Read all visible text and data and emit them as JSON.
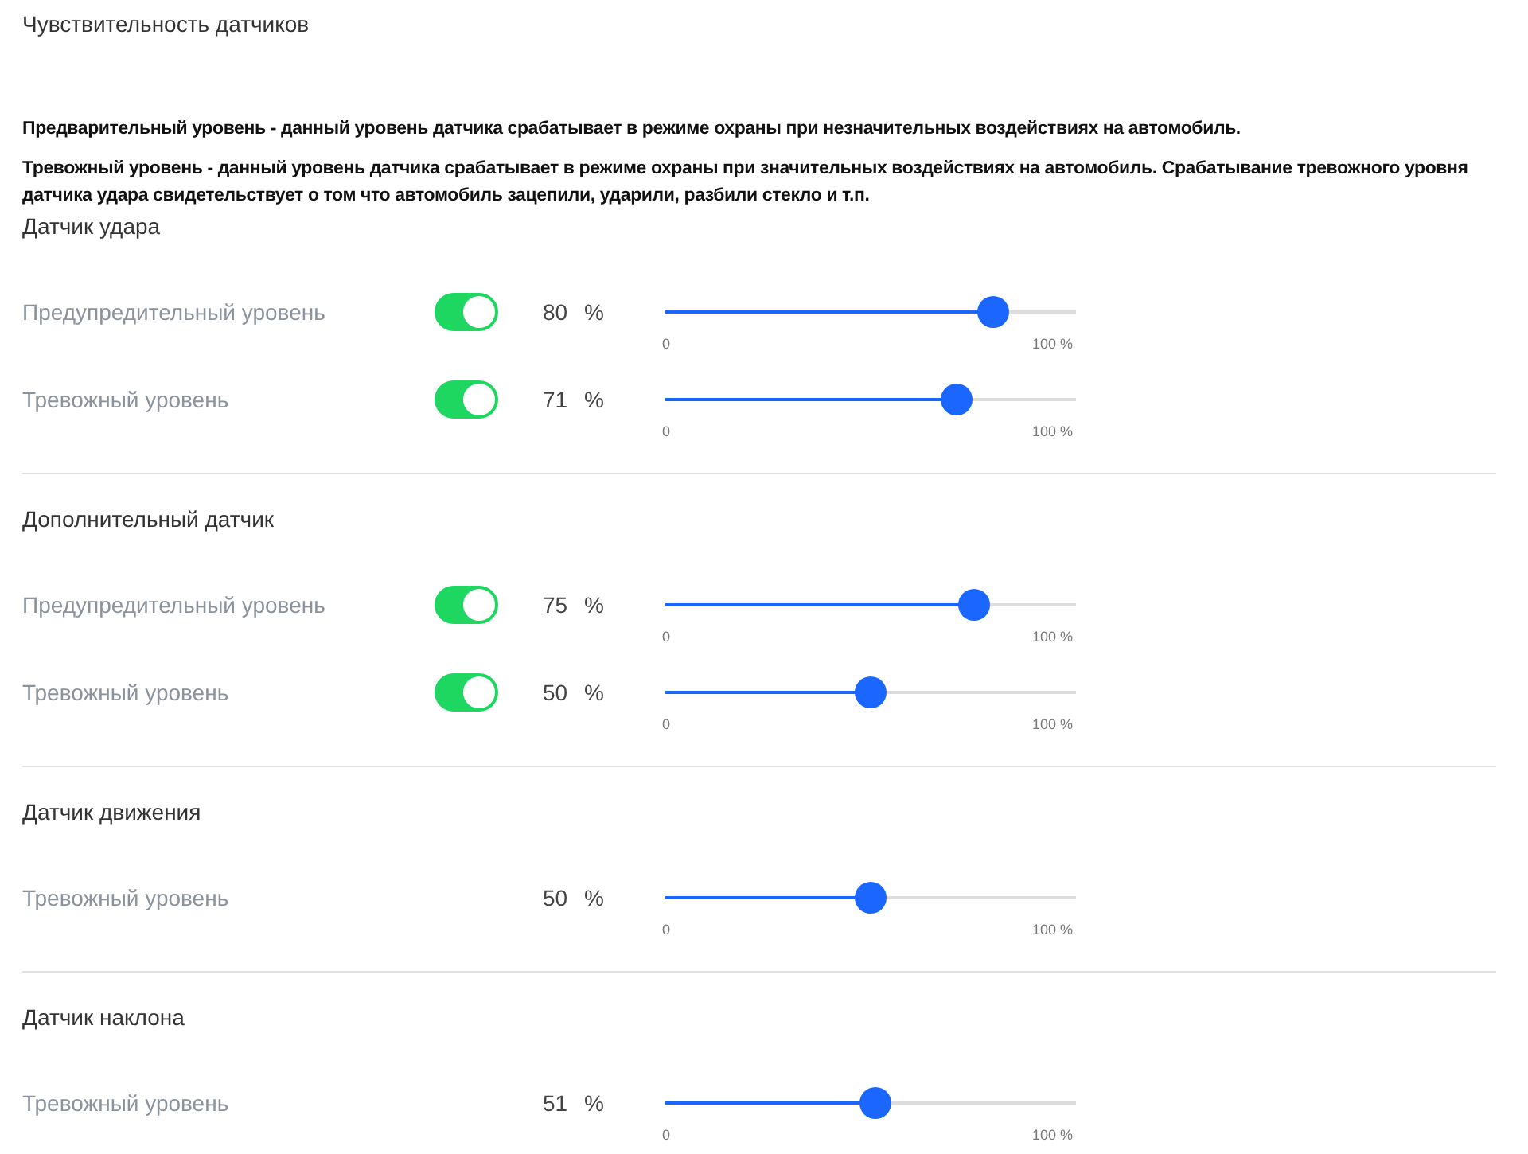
{
  "title": "Чувствительность датчиков",
  "descriptions": [
    "Предварительный уровень - данный уровень датчика срабатывает в режиме охраны при незначительных воздействиях на автомобиль.",
    "Тревожный уровень - данный уровень датчика срабатывает в режиме охраны при значительных воздействиях на автомобиль. Срабатывание тревожного уровня датчика удара свидетельствует о том что автомобиль зацепили, ударили, разбили стекло и т.п."
  ],
  "sections": [
    {
      "title": "Датчик удара",
      "rows": [
        {
          "kind": "toggle",
          "label": "Предупредительный уровень",
          "on": true,
          "value": "80",
          "unit": "%",
          "level": 0.8,
          "min_label": "0",
          "max_label": "100 %"
        },
        {
          "kind": "toggle",
          "label": "Тревожный уровень",
          "on": true,
          "value": "71",
          "unit": "%",
          "level": 0.71,
          "min_label": "0",
          "max_label": "100 %"
        }
      ]
    },
    {
      "title": "Дополнительный датчик",
      "rows": [
        {
          "kind": "toggle",
          "label": "Предупредительный уровень",
          "on": true,
          "value": "75",
          "unit": "%",
          "level": 0.75,
          "min_label": "0",
          "max_label": "100 %"
        },
        {
          "kind": "toggle",
          "label": "Тревожный уровень",
          "on": true,
          "value": "50",
          "unit": "%",
          "level": 0.5,
          "min_label": "0",
          "max_label": "100 %"
        }
      ]
    },
    {
      "title": "Датчик движения",
      "rows": [
        {
          "kind": "plain",
          "label": "Тревожный уровень",
          "value": "50",
          "unit": "%",
          "level": 0.5,
          "min_label": "0",
          "max_label": "100 %"
        }
      ]
    },
    {
      "title": "Датчик наклона",
      "rows": [
        {
          "kind": "plain",
          "label": "Тревожный уровень",
          "value": "51",
          "unit": "%",
          "level": 0.51,
          "min_label": "0",
          "max_label": "100 %"
        }
      ]
    }
  ]
}
